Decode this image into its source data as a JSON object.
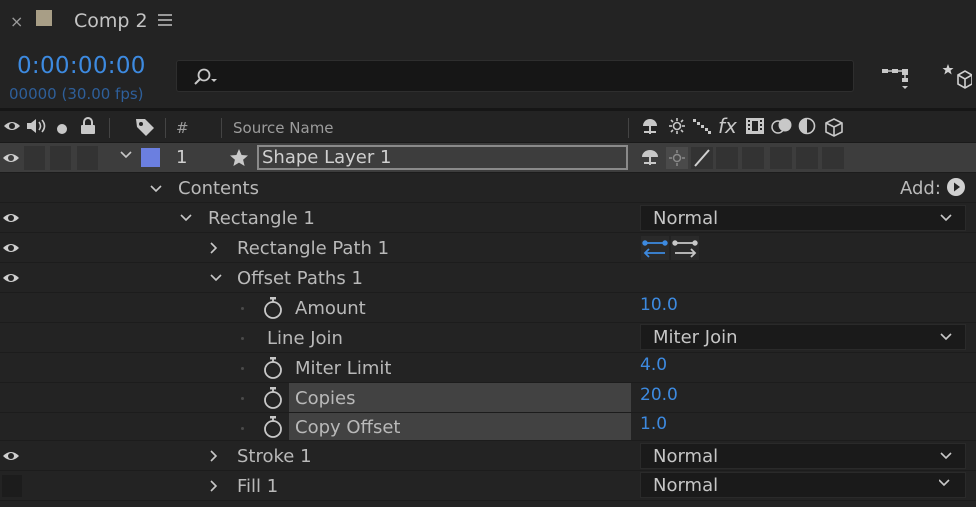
{
  "tab": {
    "close": "×",
    "title": "Comp 2",
    "swatch_color": "#a89e86"
  },
  "time": {
    "timecode": "0:00:00:00",
    "frames": "00000 (30.00 fps)"
  },
  "header": {
    "number": "#",
    "source_name": "Source Name",
    "switch_fx": "fx"
  },
  "layer": {
    "number": "1",
    "name": "Shape Layer 1",
    "label_color": "#6b7fe0"
  },
  "contents": {
    "label": "Contents",
    "add_label": "Add:"
  },
  "rectangle": {
    "label": "Rectangle 1",
    "blend_mode": "Normal"
  },
  "rect_path": {
    "label": "Rectangle Path 1"
  },
  "offset_paths": {
    "label": "Offset Paths 1"
  },
  "amount": {
    "label": "Amount",
    "value": "10.0"
  },
  "line_join": {
    "label": "Line Join",
    "value": "Miter Join"
  },
  "miter_limit": {
    "label": "Miter Limit",
    "value": "4.0"
  },
  "copies": {
    "label": "Copies",
    "value": "20.0"
  },
  "copy_offset": {
    "label": "Copy Offset",
    "value": "1.0"
  },
  "stroke": {
    "label": "Stroke 1",
    "blend_mode": "Normal"
  },
  "fill": {
    "label": "Fill 1",
    "blend_mode": "Normal"
  },
  "colors": {
    "accent_blue": "#3d8ae0",
    "background": "#232323"
  }
}
